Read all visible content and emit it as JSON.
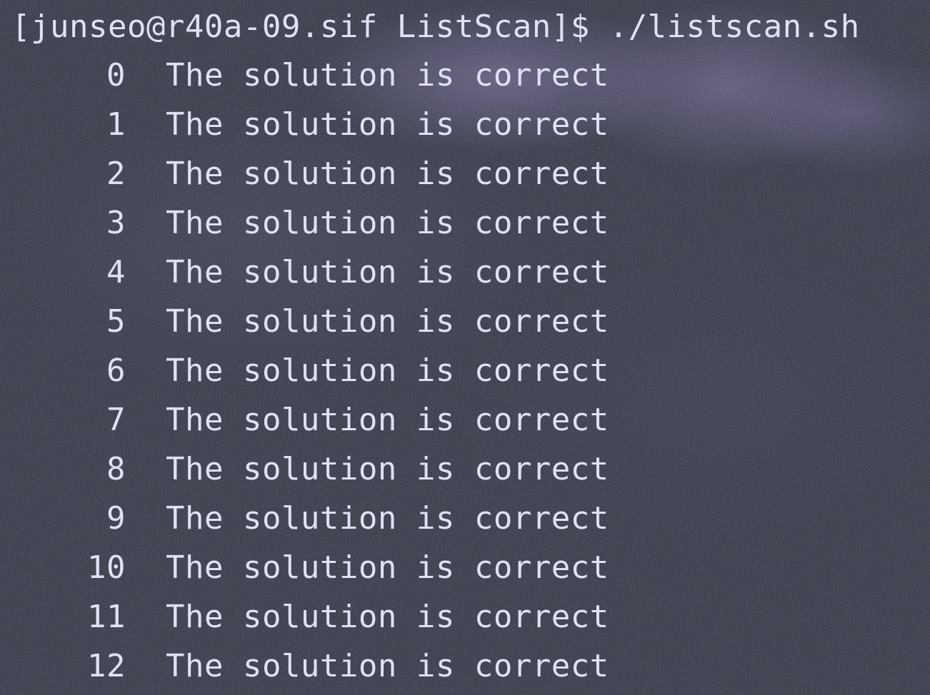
{
  "terminal": {
    "prompt": "[junseo@r40a-09.sif ListScan]$ ./listscan.sh",
    "rows": [
      {
        "index": "0",
        "message": "The solution is correct"
      },
      {
        "index": "1",
        "message": "The solution is correct"
      },
      {
        "index": "2",
        "message": "The solution is correct"
      },
      {
        "index": "3",
        "message": "The solution is correct"
      },
      {
        "index": "4",
        "message": "The solution is correct"
      },
      {
        "index": "5",
        "message": "The solution is correct"
      },
      {
        "index": "6",
        "message": "The solution is correct"
      },
      {
        "index": "7",
        "message": "The solution is correct"
      },
      {
        "index": "8",
        "message": "The solution is correct"
      },
      {
        "index": "9",
        "message": "The solution is correct"
      },
      {
        "index": "10",
        "message": "The solution is correct"
      },
      {
        "index": "11",
        "message": "The solution is correct"
      },
      {
        "index": "12",
        "message": "The solution is correct"
      }
    ]
  },
  "colors": {
    "background": "#2b2e3f",
    "text": "#dfe1f4",
    "glow": "#8278af"
  }
}
